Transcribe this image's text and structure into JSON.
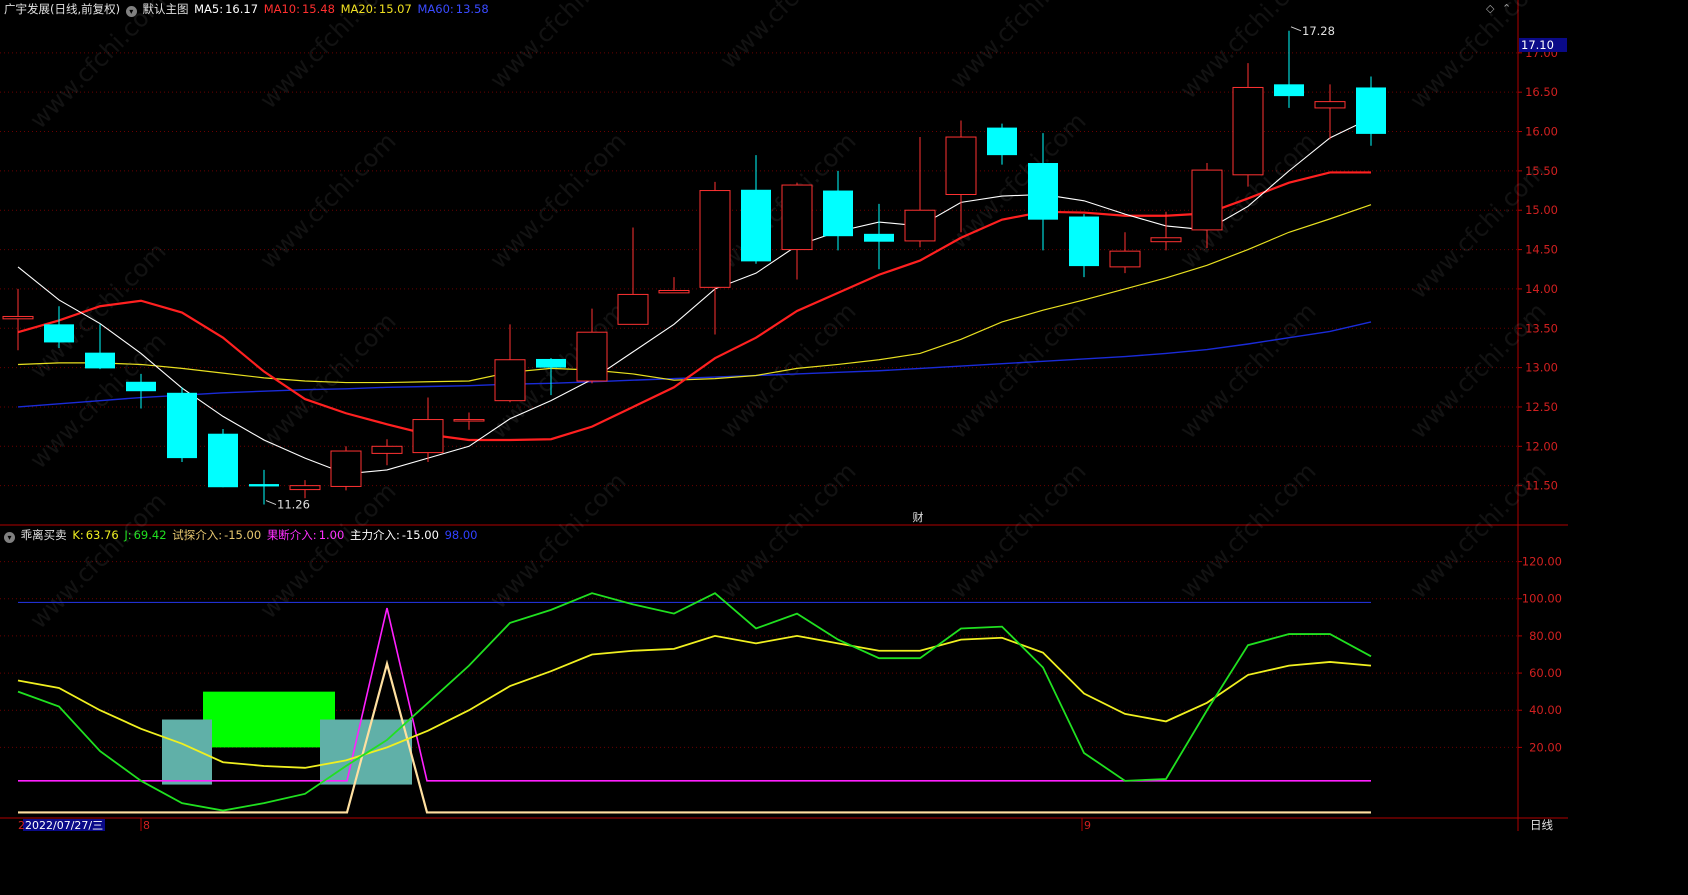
{
  "header_main": {
    "stock_name": "广宇发展(日线,前复权)",
    "chart_name": "默认主图",
    "ma5_label": "MA5:",
    "ma5_value": "16.17",
    "ma10_label": "MA10:",
    "ma10_value": "15.48",
    "ma20_label": "MA20:",
    "ma20_value": "15.07",
    "ma60_label": "MA60:",
    "ma60_value": "13.58"
  },
  "header_sub": {
    "indicator_name": "乖离买卖",
    "k_label": "K:",
    "k_value": "63.76",
    "j_label": "J:",
    "j_value": "69.42",
    "try_label": "试探介入:",
    "try_value": "-15.00",
    "decisive_label": "果断介入:",
    "decisive_value": "1.00",
    "main_label": "主力介入:",
    "main_value": "-15.00",
    "extra_value": "98.00"
  },
  "labels": {
    "last_price": "17.10",
    "high_mark": "17.28",
    "low_mark": "11.26",
    "cai_icon": "财",
    "date_cursor": "2022/07/27/三",
    "bottom_left_mark": "2",
    "month_mark_8": "8",
    "month_mark_9": "9",
    "period": "日线",
    "watermark": "www.cfchi.com"
  },
  "colors": {
    "up": "#ff3232",
    "down": "#00ffff",
    "ma5": "#ffffff",
    "ma10": "#ff2020",
    "ma20": "#e8e020",
    "ma60": "#1a2bd8",
    "k_line": "#20e020",
    "d_line": "#f0f020",
    "magenta": "#ff20ff",
    "axis": "#b00000",
    "grid": "#6a0000"
  },
  "chart_data": {
    "type": "candlestick",
    "price_ticks": [
      "17.00",
      "16.50",
      "16.00",
      "15.50",
      "15.00",
      "14.50",
      "14.00",
      "13.50",
      "13.00",
      "12.50",
      "12.00",
      "11.50"
    ],
    "price_tick_values": [
      17.0,
      16.5,
      16.0,
      15.5,
      15.0,
      14.5,
      14.0,
      13.5,
      13.0,
      12.5,
      12.0,
      11.5
    ],
    "ylim": [
      11.0,
      17.43
    ],
    "candles": [
      {
        "o": 13.62,
        "h": 14.0,
        "l": 13.22,
        "c": 13.65
      },
      {
        "o": 13.55,
        "h": 13.78,
        "l": 13.25,
        "c": 13.32
      },
      {
        "o": 13.19,
        "h": 13.55,
        "l": 12.98,
        "c": 12.99
      },
      {
        "o": 12.82,
        "h": 12.92,
        "l": 12.48,
        "c": 12.7
      },
      {
        "o": 12.68,
        "h": 12.75,
        "l": 11.8,
        "c": 11.85
      },
      {
        "o": 12.16,
        "h": 12.22,
        "l": 11.48,
        "c": 11.48
      },
      {
        "o": 11.52,
        "h": 11.7,
        "l": 11.26,
        "c": 11.49
      },
      {
        "o": 11.45,
        "h": 11.57,
        "l": 11.34,
        "c": 11.5
      },
      {
        "o": 11.49,
        "h": 12.0,
        "l": 11.44,
        "c": 11.94
      },
      {
        "o": 11.91,
        "h": 12.09,
        "l": 11.76,
        "c": 12.0
      },
      {
        "o": 11.92,
        "h": 12.62,
        "l": 11.8,
        "c": 12.34
      },
      {
        "o": 12.34,
        "h": 12.43,
        "l": 12.21,
        "c": 12.34
      },
      {
        "o": 12.58,
        "h": 13.55,
        "l": 12.56,
        "c": 13.1
      },
      {
        "o": 13.11,
        "h": 13.12,
        "l": 12.65,
        "c": 13.0
      },
      {
        "o": 12.83,
        "h": 13.75,
        "l": 12.8,
        "c": 13.45
      },
      {
        "o": 13.55,
        "h": 14.78,
        "l": 13.55,
        "c": 13.93
      },
      {
        "o": 13.95,
        "h": 14.15,
        "l": 13.95,
        "c": 13.98
      },
      {
        "o": 14.02,
        "h": 15.36,
        "l": 13.42,
        "c": 15.25
      },
      {
        "o": 15.26,
        "h": 15.7,
        "l": 14.32,
        "c": 14.35
      },
      {
        "o": 14.5,
        "h": 15.35,
        "l": 14.12,
        "c": 15.32
      },
      {
        "o": 15.25,
        "h": 15.5,
        "l": 14.49,
        "c": 14.67
      },
      {
        "o": 14.7,
        "h": 15.08,
        "l": 14.25,
        "c": 14.6
      },
      {
        "o": 14.61,
        "h": 15.93,
        "l": 14.53,
        "c": 15.0
      },
      {
        "o": 15.2,
        "h": 16.14,
        "l": 14.72,
        "c": 15.93
      },
      {
        "o": 16.05,
        "h": 16.1,
        "l": 15.58,
        "c": 15.7
      },
      {
        "o": 15.6,
        "h": 15.98,
        "l": 14.49,
        "c": 14.88
      },
      {
        "o": 14.92,
        "h": 14.95,
        "l": 14.15,
        "c": 14.29
      },
      {
        "o": 14.28,
        "h": 14.72,
        "l": 14.2,
        "c": 14.48
      },
      {
        "o": 14.6,
        "h": 14.98,
        "l": 14.49,
        "c": 14.65
      },
      {
        "o": 14.75,
        "h": 15.6,
        "l": 14.52,
        "c": 15.51
      },
      {
        "o": 15.45,
        "h": 16.87,
        "l": 15.3,
        "c": 16.56
      },
      {
        "o": 16.6,
        "h": 17.28,
        "l": 16.3,
        "c": 16.45
      },
      {
        "o": 16.3,
        "h": 16.6,
        "l": 15.9,
        "c": 16.38
      },
      {
        "o": 16.56,
        "h": 16.7,
        "l": 15.82,
        "c": 15.97
      }
    ],
    "ma5": [
      14.28,
      13.86,
      13.56,
      13.18,
      12.74,
      12.38,
      12.08,
      11.85,
      11.65,
      11.7,
      11.85,
      12.0,
      12.35,
      12.58,
      12.85,
      13.2,
      13.55,
      14.0,
      14.2,
      14.55,
      14.73,
      14.85,
      14.8,
      15.1,
      15.18,
      15.2,
      15.12,
      14.95,
      14.8,
      14.75,
      15.05,
      15.5,
      15.92,
      16.17
    ],
    "ma10": [
      13.45,
      13.6,
      13.78,
      13.85,
      13.7,
      13.38,
      12.95,
      12.6,
      12.42,
      12.28,
      12.15,
      12.08,
      12.08,
      12.09,
      12.25,
      12.5,
      12.75,
      13.12,
      13.38,
      13.72,
      13.95,
      14.18,
      14.36,
      14.65,
      14.88,
      14.98,
      14.97,
      14.93,
      14.93,
      14.96,
      15.15,
      15.35,
      15.48,
      15.48
    ],
    "ma20": [
      13.04,
      13.06,
      13.06,
      13.04,
      12.99,
      12.93,
      12.87,
      12.83,
      12.81,
      12.81,
      12.82,
      12.83,
      12.94,
      12.99,
      12.97,
      12.92,
      12.84,
      12.86,
      12.9,
      12.99,
      13.04,
      13.1,
      13.18,
      13.36,
      13.58,
      13.73,
      13.86,
      14.0,
      14.14,
      14.3,
      14.5,
      14.72,
      14.89,
      15.07
    ],
    "ma60": [
      12.5,
      12.54,
      12.58,
      12.62,
      12.65,
      12.68,
      12.7,
      12.72,
      12.73,
      12.75,
      12.76,
      12.77,
      12.79,
      12.8,
      12.82,
      12.84,
      12.86,
      12.88,
      12.9,
      12.92,
      12.94,
      12.96,
      12.99,
      13.02,
      13.05,
      13.08,
      13.11,
      13.14,
      13.18,
      13.23,
      13.3,
      13.38,
      13.46,
      13.58
    ],
    "osc_ticks": [
      "120.00",
      "100.00",
      "80.00",
      "60.00",
      "40.00",
      "20.00"
    ],
    "osc_tick_values": [
      120,
      100,
      80,
      60,
      40,
      20
    ],
    "osc_ylim": [
      -18,
      130
    ],
    "k_values": [
      50,
      42,
      18,
      2,
      -10,
      -14,
      -10,
      -5,
      10,
      24,
      44,
      64,
      87,
      94,
      103,
      97,
      92,
      103,
      84,
      92,
      78,
      68,
      68,
      84,
      85,
      63,
      17,
      2,
      3,
      40,
      75,
      81,
      81,
      69
    ],
    "d_values": [
      56,
      52,
      40,
      30,
      22,
      12,
      10,
      9,
      13,
      20,
      29,
      40,
      53,
      61,
      70,
      72,
      73,
      80,
      76,
      80,
      76,
      72,
      72,
      78,
      79,
      71,
      49,
      38,
      34,
      44,
      59,
      64,
      66,
      64
    ],
    "level_98": 98,
    "magenta_baseline": 2,
    "magenta_spike": 95,
    "white_spike": 65,
    "try_blocks_index": [
      4,
      8
    ],
    "decisive_block_index": [
      5,
      7
    ]
  }
}
